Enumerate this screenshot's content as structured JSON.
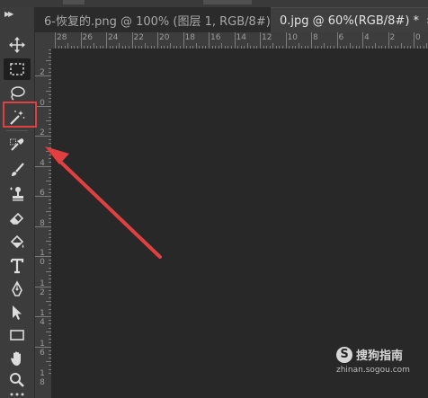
{
  "tabs": [
    {
      "title": "6-恢复的.png @ 100% (图层 1, RGB/8#) *",
      "close": "✖",
      "active": false
    },
    {
      "title": "0.jpg @ 60%(RGB/8#) *",
      "close": "✖",
      "active": true
    }
  ],
  "ruler_top": [
    "28",
    "26",
    "24",
    "22",
    "20",
    "18",
    "16",
    "14",
    "12",
    "10",
    "8",
    "6",
    "4",
    "2",
    "0"
  ],
  "ruler_left": [
    "2",
    "0",
    "2",
    "4",
    "6",
    "8",
    "10",
    "12",
    "14",
    "16",
    "18"
  ],
  "tools": [
    {
      "name": "move-tool",
      "icon": "move-icon"
    },
    {
      "name": "marquee-tool",
      "icon": "rect-marquee-icon"
    },
    {
      "name": "lasso-tool",
      "icon": "lasso-icon"
    },
    {
      "name": "magic-wand-tool",
      "icon": "magic-wand-icon",
      "highlighted": true
    },
    {
      "name": "eyedropper-tool",
      "icon": "eyedropper-icon"
    },
    {
      "name": "brush-tool",
      "icon": "brush-icon"
    },
    {
      "name": "clone-stamp-tool",
      "icon": "stamp-icon"
    },
    {
      "name": "eraser-tool",
      "icon": "eraser-icon"
    },
    {
      "name": "paint-bucket-tool",
      "icon": "bucket-icon"
    },
    {
      "name": "type-tool",
      "icon": "type-icon",
      "label": "T"
    },
    {
      "name": "pen-tool",
      "icon": "pen-icon"
    },
    {
      "name": "path-selection-tool",
      "icon": "arrow-select-icon"
    },
    {
      "name": "rectangle-tool",
      "icon": "rectangle-icon"
    },
    {
      "name": "hand-tool",
      "icon": "hand-icon"
    },
    {
      "name": "zoom-tool",
      "icon": "zoom-icon"
    }
  ],
  "watermark": {
    "logo_letter": "S",
    "logo_text": "搜狗指南",
    "domain": "zhinan.sogou.com"
  },
  "colors": {
    "annotation_red": "#e24040",
    "panel": "#3c3c3c",
    "canvas": "#282828"
  }
}
